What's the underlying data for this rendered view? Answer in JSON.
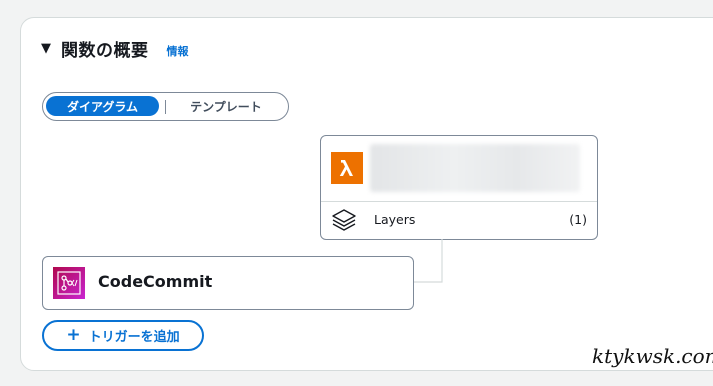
{
  "section": {
    "title": "関数の概要",
    "info_link": "情報",
    "collapse_icon": "caret-down-icon"
  },
  "view_toggle": {
    "options": [
      "ダイアグラム",
      "テンプレート"
    ],
    "selected": "ダイアグラム"
  },
  "function_node": {
    "icon": "lambda-icon",
    "icon_color": "#ed7100",
    "name_redacted": true,
    "layers": {
      "icon": "layers-icon",
      "label": "Layers",
      "count": "(1)"
    }
  },
  "trigger_node": {
    "icon": "codecommit-icon",
    "label": "CodeCommit"
  },
  "add_trigger": {
    "label": "トリガーを追加",
    "icon": "plus-icon"
  },
  "watermark": "ktykwsk.com",
  "colors": {
    "accent": "#0972d3",
    "lambda_orange": "#ed7100",
    "border": "#7d8998"
  }
}
